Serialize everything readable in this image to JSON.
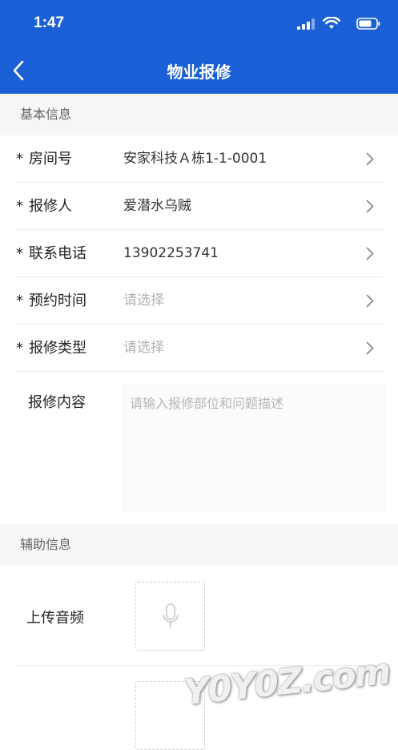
{
  "status_bar": {
    "time": "1:47"
  },
  "nav": {
    "title": "物业报修"
  },
  "basic_section": {
    "title": "基本信息",
    "rows": [
      {
        "label": "房间号",
        "required": "*",
        "value": "安家科技Ａ栋1-1-0001",
        "is_placeholder": false
      },
      {
        "label": "报修人",
        "required": "*",
        "value": "爱潜水乌贼",
        "is_placeholder": false
      },
      {
        "label": "联系电话",
        "required": "*",
        "value": "13902253741",
        "is_placeholder": false
      },
      {
        "label": "预约时间",
        "required": "*",
        "value": "请选择",
        "is_placeholder": true
      },
      {
        "label": "报修类型",
        "required": "*",
        "value": "请选择",
        "is_placeholder": true
      }
    ],
    "content_label": "报修内容",
    "content_placeholder": "请输入报修部位和问题描述"
  },
  "aux_section": {
    "title": "辅助信息",
    "upload_audio_label": "上传音频"
  },
  "watermark": "Y0Y0Z.com",
  "colors": {
    "header": "#1a5fd6",
    "section_bg": "#f5f6f8",
    "placeholder": "#b0b0b0"
  }
}
